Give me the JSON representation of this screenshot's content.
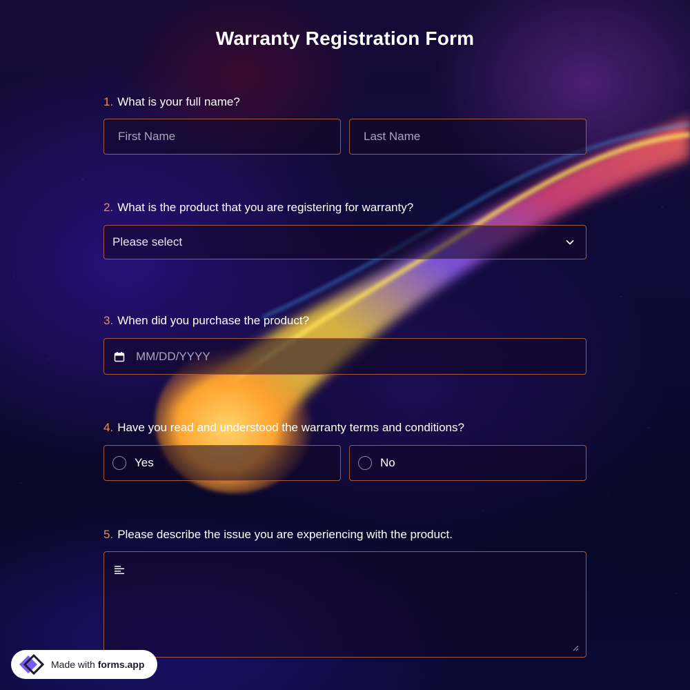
{
  "form": {
    "title": "Warranty Registration Form",
    "accent_color": "#f28a4a",
    "border_color": "#a35a3c"
  },
  "questions": [
    {
      "number": "1.",
      "label": "What is your full name?",
      "first_name_placeholder": "First Name",
      "last_name_placeholder": "Last Name"
    },
    {
      "number": "2.",
      "label": "What is the product that you are registering for warranty?",
      "select_value": "Please select",
      "icon": "chevron-down-icon"
    },
    {
      "number": "3.",
      "label": "When did you purchase the product?",
      "date_placeholder": "MM/DD/YYYY",
      "icon": "calendar-icon"
    },
    {
      "number": "4.",
      "label": "Have you read and understood the warranty terms and conditions?",
      "options": [
        "Yes",
        "No"
      ]
    },
    {
      "number": "5.",
      "label": "Please describe the issue you are experiencing with the product.",
      "icon": "paragraph-icon",
      "value": ""
    }
  ],
  "badge": {
    "prefix": "Made with ",
    "brand": "forms.app",
    "icon": "forms-app-logo-icon"
  }
}
